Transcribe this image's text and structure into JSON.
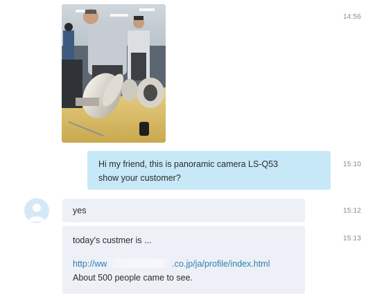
{
  "messages": {
    "photo": {
      "time": "14:56"
    },
    "outgoing": {
      "line1": "Hi my friend, this is panoramic camera LS-Q53",
      "line2": "show your customer?",
      "time": "15:10"
    },
    "incoming": [
      {
        "text": "yes",
        "time": "15:12"
      },
      {
        "line1": "today's custmer is ...",
        "link_prefix": "http://ww",
        "link_suffix": ".co.jp/ja/profile/index.html",
        "line3": "About 500 people came to see.",
        "time": "15:13"
      }
    ]
  },
  "colors": {
    "outgoing_bubble": "#c7e8f7",
    "incoming_bubble": "#eef0f7",
    "avatar": "#d3e9f6",
    "link": "#2e7fb3",
    "timestamp": "#8a8a8a"
  }
}
